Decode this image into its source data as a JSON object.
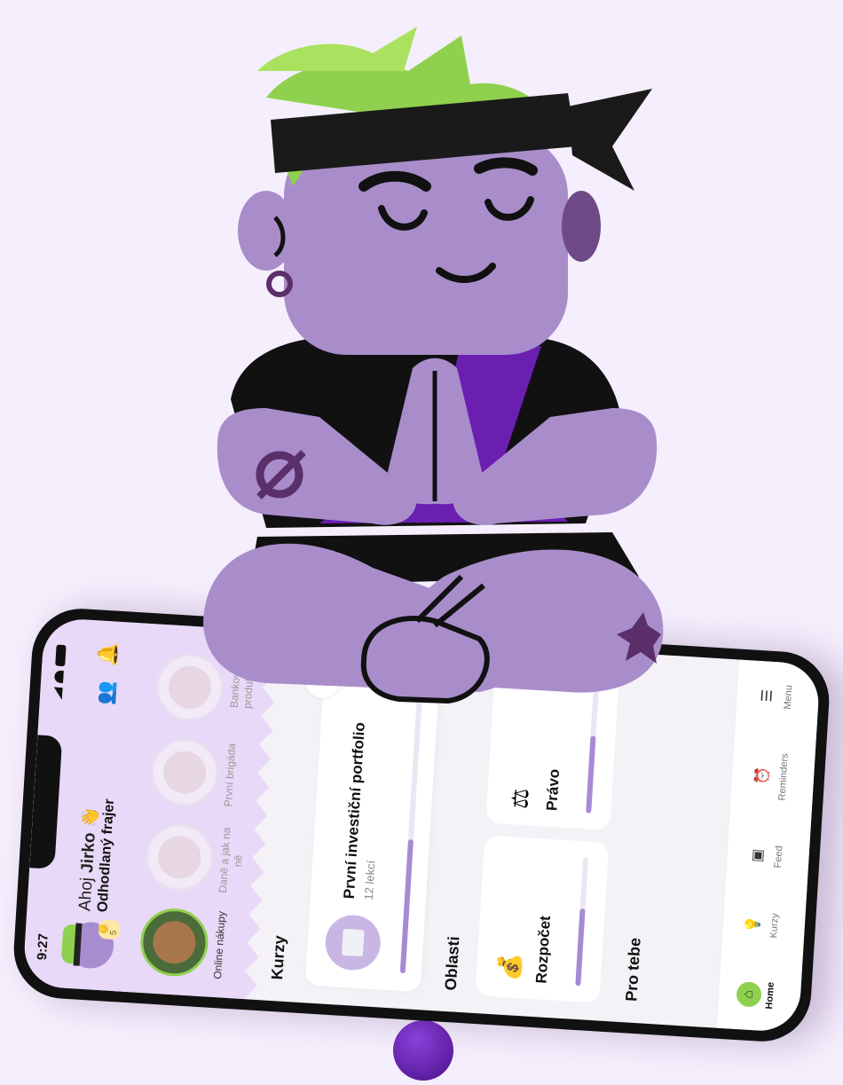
{
  "status_bar": {
    "time": "9:27"
  },
  "header": {
    "greeting_prefix": "Ahoj ",
    "greeting_name": "Jirko",
    "greeting_emoji": "👋",
    "subtitle": "Odhodlaný frajer",
    "coin_count": "5",
    "icons": [
      "bell-icon",
      "friends-icon"
    ]
  },
  "stories": [
    {
      "label": "Online nákupy",
      "active": true
    },
    {
      "label": "Daně a jak na ně",
      "active": false
    },
    {
      "label": "První brigáda",
      "active": false
    },
    {
      "label": "Bankov produkt",
      "active": false
    }
  ],
  "courses": {
    "title": "Kurzy",
    "card": {
      "title": "První investiční portfolio",
      "lessons": "12 lekcí",
      "progress": 0.45
    }
  },
  "areas": {
    "title": "Oblasti",
    "items": [
      {
        "name": "Rozpočet",
        "icon": "money-bag-icon",
        "progress": 0.6
      },
      {
        "name": "Právo",
        "icon": "scales-icon",
        "progress": 0.6
      }
    ]
  },
  "pro_tebe": {
    "title": "Pro tebe"
  },
  "tabbar": {
    "tabs": [
      {
        "label": "Home",
        "icon": "home-icon",
        "active": true
      },
      {
        "label": "Kurzy",
        "icon": "bulb-icon",
        "active": false
      },
      {
        "label": "Feed",
        "icon": "feed-icon",
        "active": false
      },
      {
        "label": "Reminders",
        "icon": "alarm-icon",
        "active": false
      },
      {
        "label": "Menu",
        "icon": "menu-icon",
        "active": false
      }
    ]
  },
  "colors": {
    "accent": "#8fd14f",
    "purple": "#a88ad4",
    "header_bg": "#e8d9f8"
  }
}
